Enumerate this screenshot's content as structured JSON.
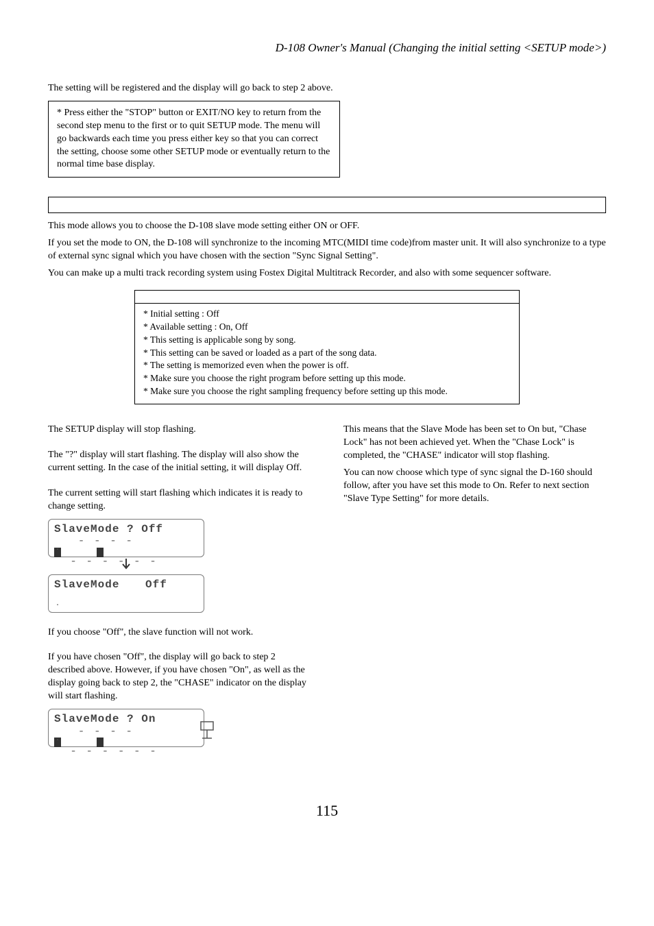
{
  "header": {
    "title": "D-108 Owner's Manual (Changing the initial setting <SETUP mode>)"
  },
  "intro": {
    "p1": "The setting will be registered and the display will go back to step 2 above."
  },
  "note_box": {
    "text": "* Press either the \"STOP\" button or EXIT/NO key to return from the second step menu to the first or to quit SETUP mode.  The menu will go backwards each time you press either key so that you can correct the setting, choose some other SETUP mode or eventually return to the normal time base display."
  },
  "section": {
    "p1": "This mode allows you to choose the D-108 slave mode setting either ON or OFF.",
    "p2": "If you set the mode to ON, the D-108 will synchronize to the incoming MTC(MIDI time code)from master unit.  It will also synchronize to a type of  external sync signal which you have chosen with the section \"Sync Signal Setting\".",
    "p3": "You can make up a multi track recording system using Fostex Digital Multitrack Recorder, and also with some sequencer software."
  },
  "info_list": {
    "i1": "* Initial setting : Off",
    "i2": "* Available setting : On, Off",
    "i3": "* This setting is applicable song by song.",
    "i4": "* This setting can be saved or loaded as a part of the song data.",
    "i5": "* The setting is memorized even when the power is off.",
    "i6": "* Make sure you choose the right program before setting up this mode.",
    "i7": "* Make sure you choose the right sampling frequency before setting up this mode."
  },
  "left": {
    "p1": "The SETUP display will stop flashing.",
    "p2": "The \"?\" display will start flashing.  The display will also show the current setting.  In the case of the initial setting, it will display Off.",
    "p3": "The current setting will start flashing which indicates it is ready to change setting.",
    "lcd1": "SlaveMode ? Off",
    "lcd2a": "SlaveMode",
    "lcd2b": "Off",
    "p4": "If you choose \"Off\", the slave function will not work.",
    "p5": "If you have chosen \"Off\", the display will go back to step 2 described above.  However, if you have chosen \"On\", as well as the display going back to step 2, the \"CHASE\" indicator on the display will start flashing.",
    "lcd3": "SlaveMode ? On"
  },
  "right": {
    "p1": "This means that the Slave Mode has been set to On but, \"Chase Lock\" has not been achieved yet.  When the \"Chase Lock\" is completed, the \"CHASE\" indicator will stop flashing.",
    "p2": "You can now choose which type of sync signal the D-160 should follow, after you have set this mode to On.  Refer to next section \"Slave Type Setting\" for more details."
  },
  "page_number": "115"
}
